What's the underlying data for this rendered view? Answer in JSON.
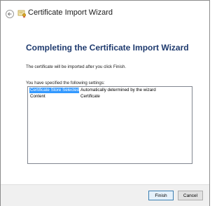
{
  "window": {
    "title": "Certificate Import Wizard",
    "back_icon": "back-arrow-icon",
    "app_icon": "certificate-icon"
  },
  "main": {
    "heading": "Completing the Certificate Import Wizard",
    "description": "The certificate will be imported after you click Finish.",
    "settings_label": "You have specified the following settings:",
    "settings": [
      {
        "name": "Certificate Store Selected",
        "value": "Automatically determined by the wizard"
      },
      {
        "name": "Content",
        "value": "Certificate"
      }
    ]
  },
  "footer": {
    "finish_label": "Finish",
    "cancel_label": "Cancel"
  },
  "colors": {
    "heading": "#1e3a6e",
    "selection": "#3399ff"
  }
}
